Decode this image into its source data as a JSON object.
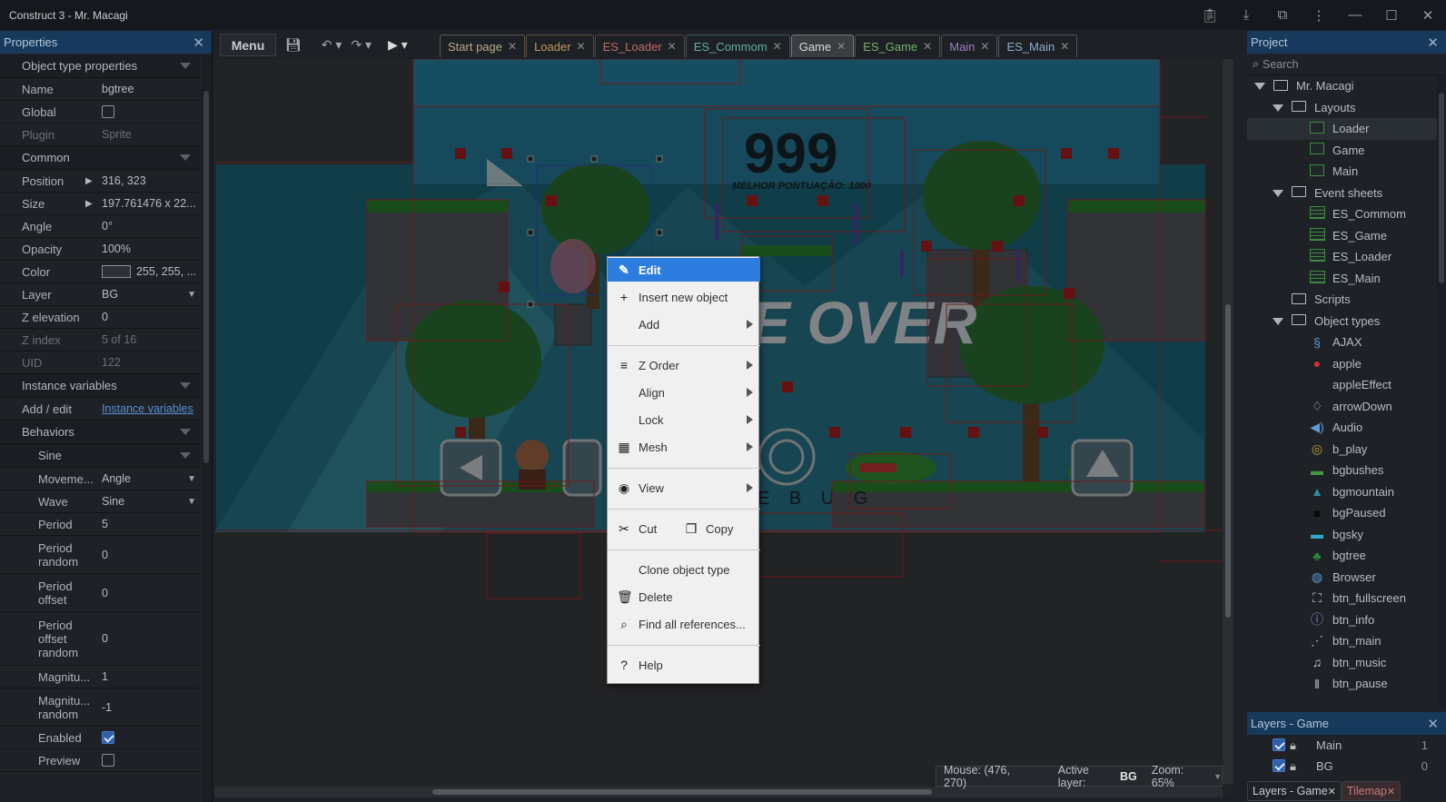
{
  "window": {
    "title": "Construct 3 - Mr. Macagi"
  },
  "properties": {
    "header": "Properties",
    "rows": [
      {
        "type": "section",
        "label": "Object type properties"
      },
      {
        "type": "row",
        "key": "Name",
        "value": "bgtree"
      },
      {
        "type": "row",
        "key": "Global",
        "check": false
      },
      {
        "type": "row",
        "key": "Plugin",
        "value": "Sprite",
        "dim": true
      },
      {
        "type": "section",
        "label": "Common"
      },
      {
        "type": "row",
        "key": "Position",
        "value": "316, 323",
        "arrow": true
      },
      {
        "type": "row",
        "key": "Size",
        "value": "197.761476 x 22...",
        "arrow": true
      },
      {
        "type": "row",
        "key": "Angle",
        "value": "0°"
      },
      {
        "type": "row",
        "key": "Opacity",
        "value": "100%"
      },
      {
        "type": "row",
        "key": "Color",
        "value": "255, 255, ...",
        "swatch": true
      },
      {
        "type": "row",
        "key": "Layer",
        "value": "BG",
        "dropdown": true
      },
      {
        "type": "row",
        "key": "Z elevation",
        "value": "0"
      },
      {
        "type": "row",
        "key": "Z index",
        "value": "5 of 16",
        "dim": true
      },
      {
        "type": "row",
        "key": "UID",
        "value": "122",
        "dim": true
      },
      {
        "type": "section",
        "label": "Instance variables"
      },
      {
        "type": "row",
        "key": "Add / edit",
        "value": "Instance variables",
        "link": true
      },
      {
        "type": "section",
        "label": "Behaviors"
      },
      {
        "type": "section",
        "label": "Sine",
        "sub": true
      },
      {
        "type": "row",
        "key": "Moveme...",
        "value": "Angle",
        "dropdown": true,
        "sub": true
      },
      {
        "type": "row",
        "key": "Wave",
        "value": "Sine",
        "dropdown": true,
        "sub": true
      },
      {
        "type": "row",
        "key": "Period",
        "value": "5",
        "sub": true
      },
      {
        "type": "row",
        "key": "Period random",
        "value": "0",
        "sub": true,
        "tall": true
      },
      {
        "type": "row",
        "key": "Period offset",
        "value": "0",
        "sub": true,
        "tall": true
      },
      {
        "type": "row",
        "key": "Period offset random",
        "value": "0",
        "sub": true,
        "tall3": true
      },
      {
        "type": "row",
        "key": "Magnitu...",
        "value": "1",
        "sub": true
      },
      {
        "type": "row",
        "key": "Magnitu... random",
        "value": "-1",
        "sub": true,
        "tall": true
      },
      {
        "type": "row",
        "key": "Enabled",
        "check": true,
        "sub": true
      },
      {
        "type": "row",
        "key": "Preview",
        "check": false,
        "sub": true
      }
    ]
  },
  "toolbar": {
    "menu_label": "Menu",
    "tabs": [
      {
        "label": "Start page",
        "color": "#b6a98a"
      },
      {
        "label": "Loader",
        "color": "#c39a5a"
      },
      {
        "label": "ES_Loader",
        "color": "#c26a6a"
      },
      {
        "label": "ES_Commom",
        "color": "#5fb1a2"
      },
      {
        "label": "Game",
        "color": "#d8d8d8",
        "active": true
      },
      {
        "label": "ES_Game",
        "color": "#7ab06a"
      },
      {
        "label": "Main",
        "color": "#9a7fc0"
      },
      {
        "label": "ES_Main",
        "color": "#8faac8"
      }
    ]
  },
  "canvas": {
    "score": "999",
    "best": "MELHOR PONTUAÇÃO: 1000",
    "gameover": "E OVER",
    "debug": "E B U G",
    "status": {
      "mouse": "Mouse: (476, 270)",
      "layer_label": "Active layer:",
      "layer_value": "BG",
      "zoom": "Zoom: 65%"
    }
  },
  "context_menu": {
    "items": [
      {
        "label": "Edit",
        "icon": "✎",
        "highlight": true
      },
      {
        "label": "Insert new object",
        "icon": "+"
      },
      {
        "label": "Add",
        "submenu": true
      },
      {
        "sep": true
      },
      {
        "label": "Z Order",
        "icon": "≡",
        "submenu": true
      },
      {
        "label": "Align",
        "submenu": true
      },
      {
        "label": "Lock",
        "submenu": true
      },
      {
        "label": "Mesh",
        "icon": "▦",
        "submenu": true
      },
      {
        "sep": true
      },
      {
        "label": "View",
        "icon": "◉",
        "submenu": true
      },
      {
        "sep": true
      },
      {
        "label": "Cut",
        "icon": "✂",
        "second": "Copy",
        "second_icon": "❐"
      },
      {
        "sep": true
      },
      {
        "label": "Clone object type"
      },
      {
        "label": "Delete",
        "icon": "🗑"
      },
      {
        "label": "Find all references...",
        "icon": "⌕"
      },
      {
        "sep": true
      },
      {
        "label": "Help",
        "icon": "?"
      }
    ]
  },
  "project": {
    "header": "Project",
    "search_placeholder": "Search",
    "tree": [
      {
        "label": "Mr. Macagi",
        "depth": 0,
        "kind": "folder",
        "expanded": true
      },
      {
        "label": "Layouts",
        "depth": 1,
        "kind": "folder",
        "expanded": true
      },
      {
        "label": "Loader",
        "depth": 2,
        "kind": "layout",
        "selected": true
      },
      {
        "label": "Game",
        "depth": 2,
        "kind": "layout"
      },
      {
        "label": "Main",
        "depth": 2,
        "kind": "layout"
      },
      {
        "label": "Event sheets",
        "depth": 1,
        "kind": "folder",
        "expanded": true
      },
      {
        "label": "ES_Commom",
        "depth": 2,
        "kind": "events"
      },
      {
        "label": "ES_Game",
        "depth": 2,
        "kind": "events"
      },
      {
        "label": "ES_Loader",
        "depth": 2,
        "kind": "events"
      },
      {
        "label": "ES_Main",
        "depth": 2,
        "kind": "events"
      },
      {
        "label": "Scripts",
        "depth": 1,
        "kind": "folder"
      },
      {
        "label": "Object types",
        "depth": 1,
        "kind": "folder",
        "expanded": true
      },
      {
        "label": "AJAX",
        "depth": 2,
        "kind": "obj",
        "glyph": "§",
        "color": "#5a9bd6"
      },
      {
        "label": "apple",
        "depth": 2,
        "kind": "obj",
        "glyph": "●",
        "color": "#d03030"
      },
      {
        "label": "appleEffect",
        "depth": 2,
        "kind": "obj",
        "glyph": "",
        "color": "#888"
      },
      {
        "label": "arrowDown",
        "depth": 2,
        "kind": "obj",
        "glyph": "♢",
        "color": "#c8ccd1"
      },
      {
        "label": "Audio",
        "depth": 2,
        "kind": "obj",
        "glyph": "◀)",
        "color": "#5a9bd6"
      },
      {
        "label": "b_play",
        "depth": 2,
        "kind": "obj",
        "glyph": "◎",
        "color": "#c0a030"
      },
      {
        "label": "bgbushes",
        "depth": 2,
        "kind": "obj",
        "glyph": "▬",
        "color": "#3f9a3f"
      },
      {
        "label": "bgmountain",
        "depth": 2,
        "kind": "obj",
        "glyph": "▲",
        "color": "#2f8aa0"
      },
      {
        "label": "bgPaused",
        "depth": 2,
        "kind": "obj",
        "glyph": "■",
        "color": "#0a0a0a"
      },
      {
        "label": "bgsky",
        "depth": 2,
        "kind": "obj",
        "glyph": "▬",
        "color": "#2fa8c8"
      },
      {
        "label": "bgtree",
        "depth": 2,
        "kind": "obj",
        "glyph": "♣",
        "color": "#2e8a3a"
      },
      {
        "label": "Browser",
        "depth": 2,
        "kind": "obj",
        "glyph": "◍",
        "color": "#5a9bd6"
      },
      {
        "label": "btn_fullscreen",
        "depth": 2,
        "kind": "obj",
        "glyph": "⛶",
        "color": "#c8ccd1"
      },
      {
        "label": "btn_info",
        "depth": 2,
        "kind": "obj",
        "glyph": "ⓘ",
        "color": "#8a8fd6"
      },
      {
        "label": "btn_main",
        "depth": 2,
        "kind": "obj",
        "glyph": "⋰",
        "color": "#c8ccd1"
      },
      {
        "label": "btn_music",
        "depth": 2,
        "kind": "obj",
        "glyph": "♫",
        "color": "#c8ccd1"
      },
      {
        "label": "btn_pause",
        "depth": 2,
        "kind": "obj",
        "glyph": "‖",
        "color": "#c8ccd1"
      }
    ]
  },
  "layers": {
    "header": "Layers - Game",
    "rows": [
      {
        "name": "Main",
        "num": "1"
      },
      {
        "name": "BG",
        "num": "0"
      }
    ],
    "tabs": [
      {
        "label": "Layers - Game",
        "color": "#c8ccd1"
      },
      {
        "label": "Tilemap",
        "color": "#c87a7a"
      }
    ]
  }
}
